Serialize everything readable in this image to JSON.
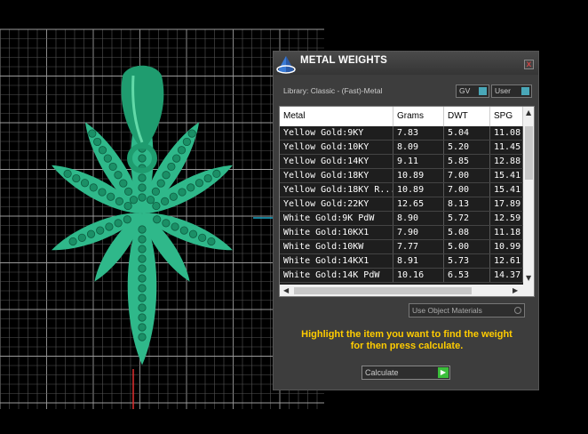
{
  "panel": {
    "title": "METAL WEIGHTS",
    "close": "x",
    "library_label": "Library: Classic - (Fast)-Metal",
    "toggles": [
      {
        "label": "GV"
      },
      {
        "label": "User"
      }
    ],
    "columns": [
      "Metal",
      "Grams",
      "DWT",
      "SPG"
    ],
    "rows": [
      [
        "Yellow Gold:9KY",
        "7.83",
        "5.04",
        "11.08"
      ],
      [
        "Yellow Gold:10KY",
        "8.09",
        "5.20",
        "11.45"
      ],
      [
        "Yellow Gold:14KY",
        "9.11",
        "5.85",
        "12.88"
      ],
      [
        "Yellow Gold:18KY",
        "10.89",
        "7.00",
        "15.41"
      ],
      [
        "Yellow Gold:18KY R...",
        "10.89",
        "7.00",
        "15.41"
      ],
      [
        "Yellow Gold:22KY",
        "12.65",
        "8.13",
        "17.89"
      ],
      [
        "White Gold:9K PdW",
        "8.90",
        "5.72",
        "12.59"
      ],
      [
        "White Gold:10KX1",
        "7.90",
        "5.08",
        "11.18"
      ],
      [
        "White Gold:10KW",
        "7.77",
        "5.00",
        "10.99"
      ],
      [
        "White Gold:14KX1",
        "8.91",
        "5.73",
        "12.61"
      ],
      [
        "White Gold:14K PdW",
        "10.16",
        "6.53",
        "14.37"
      ]
    ],
    "use_object_materials": "Use Object Materials",
    "instruction_line1": "Highlight the item you want to find the weight",
    "instruction_line2": "for then press calculate.",
    "calculate_label": "Calculate"
  },
  "colors": {
    "accent_text": "#ffcc00",
    "model_green": "#2fb88a",
    "grid": "#888888"
  }
}
